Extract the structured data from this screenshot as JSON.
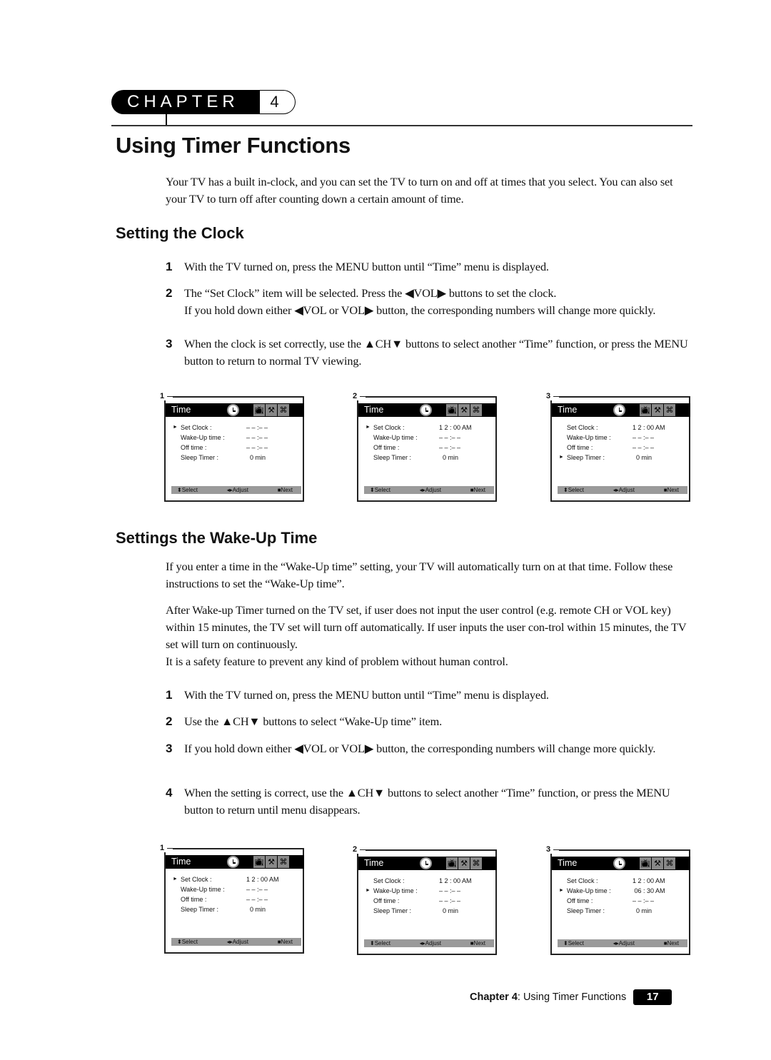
{
  "chapter": {
    "word": "CHAPTER",
    "number": "4"
  },
  "title": "Using Timer Functions",
  "intro": "Your TV has a built in-clock, and you can set the TV to turn on and off at times that you select. You can also set your TV to turn off after counting down a certain amount of time.",
  "clock_section": {
    "heading": "Setting the Clock",
    "steps": [
      {
        "n": "1",
        "text": "With the TV turned on, press the MENU button until “Time” menu is displayed."
      },
      {
        "n": "2",
        "text": "The “Set Clock” item will be selected. Press the ◀VOL▶ buttons to set the clock.",
        "text2": "If you hold down either ◀VOL or VOL▶ button, the corresponding numbers will change more quickly."
      },
      {
        "n": "3",
        "text": "When the clock is set correctly, use the ▲CH▼ buttons to select another “Time” function, or press the MENU button to return to normal TV viewing."
      }
    ],
    "screens": [
      {
        "label": "1",
        "title": "Time",
        "rows": [
          {
            "ptr": "►",
            "k": "Set Clock :",
            "v": "– – :– –"
          },
          {
            "ptr": "",
            "k": "Wake-Up time :",
            "v": "– – :– –"
          },
          {
            "ptr": "",
            "k": "Off time :",
            "v": "– – :– –"
          },
          {
            "ptr": "",
            "k": "Sleep Timer :",
            "v": "  0 min"
          }
        ]
      },
      {
        "label": "2",
        "title": "Time",
        "rows": [
          {
            "ptr": "►",
            "k": "Set Clock :",
            "v": "1 2 : 00 AM"
          },
          {
            "ptr": "",
            "k": "Wake-Up time :",
            "v": "– – :– –"
          },
          {
            "ptr": "",
            "k": "Off time :",
            "v": "– – :– –"
          },
          {
            "ptr": "",
            "k": "Sleep Timer :",
            "v": "  0 min"
          }
        ]
      },
      {
        "label": "3",
        "title": "Time",
        "rows": [
          {
            "ptr": "",
            "k": "Set Clock :",
            "v": "1 2 : 00 AM"
          },
          {
            "ptr": "",
            "k": "Wake-Up time :",
            "v": "– – :– –"
          },
          {
            "ptr": "",
            "k": "Off time :",
            "v": "– – :– –"
          },
          {
            "ptr": "►",
            "k": "Sleep Timer :",
            "v": "  0 min"
          }
        ]
      }
    ]
  },
  "wake_section": {
    "heading": "Settings the Wake-Up Time",
    "para1": "If you enter a time in the “Wake-Up time” setting, your TV will automatically turn on at that time. Follow these instructions to set the “Wake-Up time”.",
    "para2": "After Wake-up Timer turned on the TV set, if user does not input the user control (e.g. remote CH or VOL key) within 15 minutes, the TV set will turn off automatically. If user inputs the user con-trol within 15 minutes, the TV set will turn on continuously.",
    "para3": "It is a safety feature to prevent any kind of problem without human control.",
    "steps": [
      {
        "n": "1",
        "text": "With the TV turned on, press the MENU button until “Time” menu is displayed."
      },
      {
        "n": "2",
        "text": "Use the ▲CH▼ buttons to select “Wake-Up time” item."
      },
      {
        "n": "3",
        "text": "If you hold down either ◀VOL or VOL▶ button, the corresponding numbers will change more quickly."
      },
      {
        "n": "4",
        "text": "When the setting is correct, use the ▲CH▼ buttons to select another “Time” function, or press the MENU button to return until menu disappears."
      }
    ],
    "screens": [
      {
        "label": "1",
        "title": "Time",
        "rows": [
          {
            "ptr": "►",
            "k": "Set Clock :",
            "v": "1 2 : 00 AM"
          },
          {
            "ptr": "",
            "k": "Wake-Up time :",
            "v": "– – :– –"
          },
          {
            "ptr": "",
            "k": "Off time :",
            "v": "– – :– –"
          },
          {
            "ptr": "",
            "k": "Sleep Timer :",
            "v": "  0 min"
          }
        ]
      },
      {
        "label": "2",
        "title": "Time",
        "rows": [
          {
            "ptr": "",
            "k": "Set Clock :",
            "v": "1 2 : 00 AM"
          },
          {
            "ptr": "►",
            "k": "Wake-Up time :",
            "v": "– – :– –"
          },
          {
            "ptr": "",
            "k": "Off time :",
            "v": "– – :– –"
          },
          {
            "ptr": "",
            "k": "Sleep Timer :",
            "v": "  0 min"
          }
        ]
      },
      {
        "label": "3",
        "title": "Time",
        "rows": [
          {
            "ptr": "",
            "k": "Set Clock :",
            "v": "1 2 : 00 AM"
          },
          {
            "ptr": "►",
            "k": "Wake-Up time :",
            "v": " 06 : 30 AM"
          },
          {
            "ptr": "",
            "k": "Off time :",
            "v": "– – :– –"
          },
          {
            "ptr": "",
            "k": "Sleep Timer :",
            "v": "  0 min"
          }
        ]
      }
    ]
  },
  "menu_footer": {
    "select": "⬍Select",
    "adjust": "◂▸Adjust",
    "next": "■Next"
  },
  "menu_icons": [
    "clock-icon",
    "tv-icon",
    "wrench-icon",
    "gift-icon"
  ],
  "page_footer": {
    "chapter_bold": "Chapter 4",
    "chapter_rest": ": Using Timer Functions",
    "page": "17"
  }
}
